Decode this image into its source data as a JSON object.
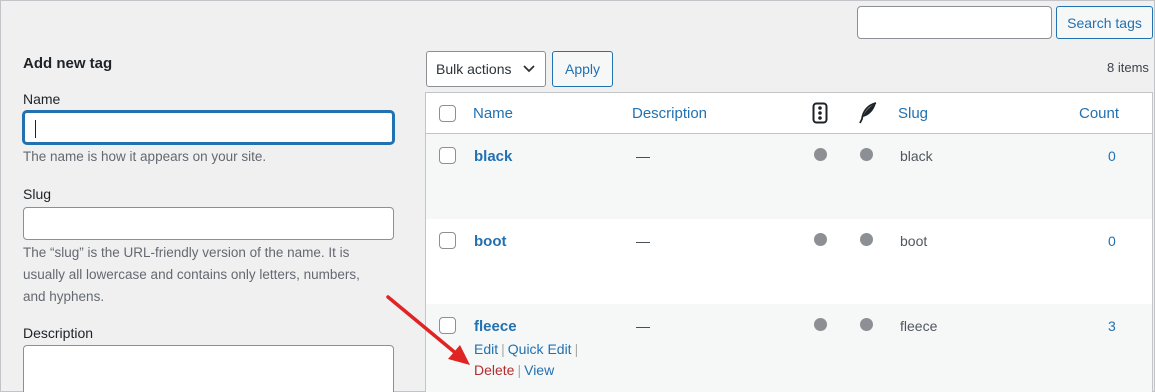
{
  "search": {
    "value": "",
    "button_label": "Search tags"
  },
  "form": {
    "title": "Add new tag",
    "name_label": "Name",
    "name_value": "",
    "name_help": "The name is how it appears on your site.",
    "slug_label": "Slug",
    "slug_value": "",
    "slug_help": "The “slug” is the URL-friendly version of the name. It is usually all lowercase and contains only letters, numbers, and hyphens.",
    "description_label": "Description"
  },
  "toolbar": {
    "bulk_actions": "Bulk actions",
    "apply_label": "Apply",
    "items_count": "8 items"
  },
  "table": {
    "columns": {
      "name": "Name",
      "description": "Description",
      "slug": "Slug",
      "count": "Count"
    },
    "column_icons": [
      "traffic-light-icon",
      "feather-icon"
    ],
    "rows": [
      {
        "name": "black",
        "description": "—",
        "slug": "black",
        "count": "0"
      },
      {
        "name": "boot",
        "description": "—",
        "slug": "boot",
        "count": "0"
      },
      {
        "name": "fleece",
        "description": "—",
        "slug": "fleece",
        "count": "3",
        "actions": {
          "edit": "Edit",
          "quick_edit": "Quick Edit",
          "delete": "Delete",
          "view": "View",
          "sep": "|"
        }
      }
    ]
  },
  "colors": {
    "accent": "#2271b1",
    "danger": "#b32d2e",
    "annotation_arrow": "#e02424"
  }
}
